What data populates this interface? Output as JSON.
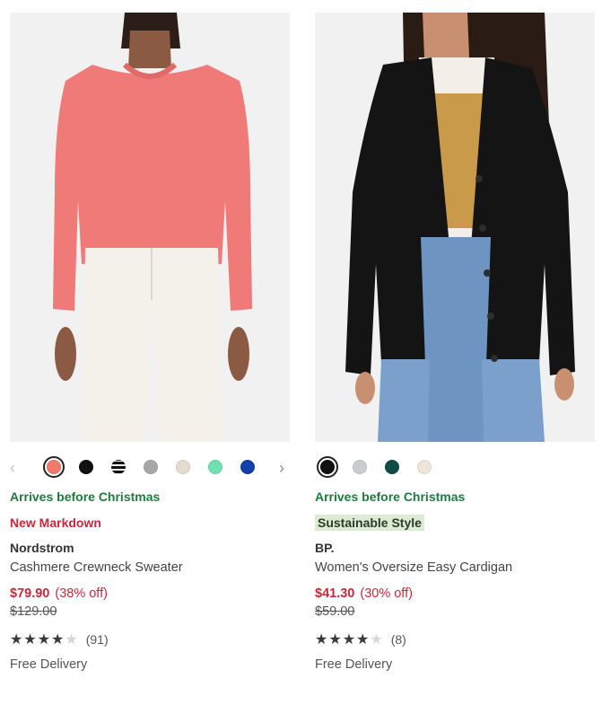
{
  "colors": {
    "arrives_green": "#1f7a3f",
    "sale_red": "#c8283c",
    "sustain_bg": "#dcebd3"
  },
  "icons": {
    "prev": "chevron-left-icon",
    "next": "chevron-right-icon",
    "star": "star-icon"
  },
  "products": [
    {
      "image_alt": "pink-crewneck-sweater-photo",
      "swatches": [
        {
          "color": "#f07a6a",
          "selected": true
        },
        {
          "color": "#111111"
        },
        {
          "color": "stripe"
        },
        {
          "color": "#a6a6a6"
        },
        {
          "color": "#e3dccf"
        },
        {
          "color": "#6fe0b0"
        },
        {
          "color": "#1240a8"
        }
      ],
      "arrives": "Arrives before Christmas",
      "tag": "New Markdown",
      "brand": "Nordstrom",
      "name": "Cashmere Crewneck Sweater",
      "sale_price": "$79.90",
      "discount": "(38% off)",
      "original_price": "$129.00",
      "rating": 4,
      "review_count": "(91)",
      "delivery": "Free Delivery"
    },
    {
      "image_alt": "black-oversize-cardigan-photo",
      "swatches": [
        {
          "color": "#111111",
          "selected": true
        },
        {
          "color": "#c9ccd1"
        },
        {
          "color": "#0f4a47"
        },
        {
          "color": "#ece6da"
        }
      ],
      "arrives": "Arrives before Christmas",
      "tag": "Sustainable Style",
      "brand": "BP.",
      "name": "Women's Oversize Easy Cardigan",
      "sale_price": "$41.30",
      "discount": "(30% off)",
      "original_price": "$59.00",
      "rating": 4,
      "review_count": "(8)",
      "delivery": "Free Delivery"
    }
  ]
}
